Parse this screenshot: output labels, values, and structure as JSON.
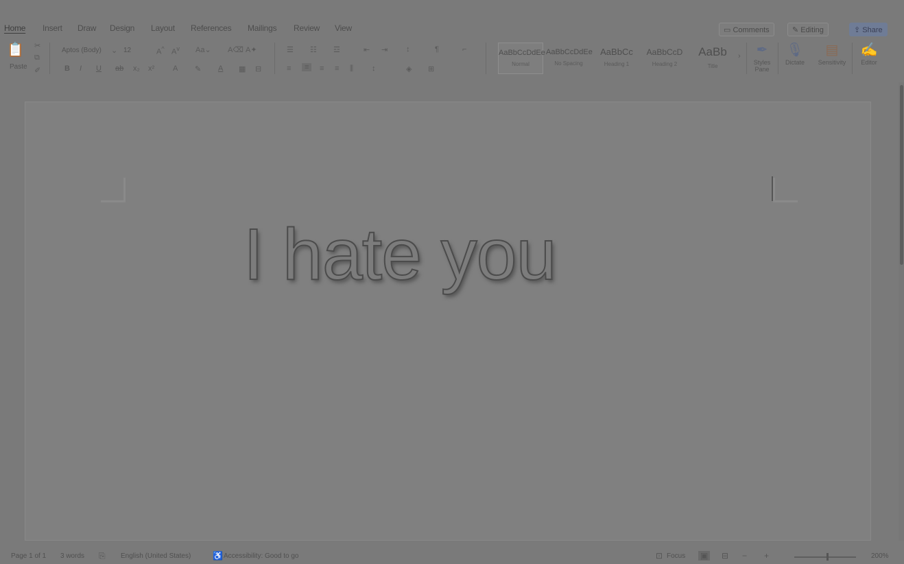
{
  "tabs": [
    {
      "label": "Home",
      "active": true
    },
    {
      "label": "Insert"
    },
    {
      "label": "Draw"
    },
    {
      "label": "Design"
    },
    {
      "label": "Layout"
    },
    {
      "label": "References"
    },
    {
      "label": "Mailings"
    },
    {
      "label": "Review"
    },
    {
      "label": "View"
    }
  ],
  "top_buttons": {
    "comments": "Comments",
    "editing": "Editing",
    "share": "Share"
  },
  "ribbon": {
    "paste_label": "Paste",
    "font_name": "Aptos (Body)",
    "font_size": "12",
    "styles": [
      {
        "preview": "AaBbCcDdEe",
        "name": "Normal",
        "selected": true
      },
      {
        "preview": "AaBbCcDdEe",
        "name": "No Spacing"
      },
      {
        "preview": "AaBbCc",
        "name": "Heading 1"
      },
      {
        "preview": "AaBbCcD",
        "name": "Heading 2"
      },
      {
        "preview": "AaBb",
        "name": "Title"
      }
    ],
    "styles_pane_label": "Styles Pane",
    "dictate_label": "Dictate",
    "sensitivity_label": "Sensitivity",
    "editor_label": "Editor"
  },
  "document": {
    "text": "I hate you"
  },
  "status": {
    "page": "Page 1 of 1",
    "words": "3 words",
    "language": "English (United States)",
    "accessibility": "Accessibility: Good to go",
    "focus": "Focus",
    "zoom": "200%"
  },
  "colors": {
    "accent": "#6f7c96",
    "background": "#7a7a7a"
  }
}
